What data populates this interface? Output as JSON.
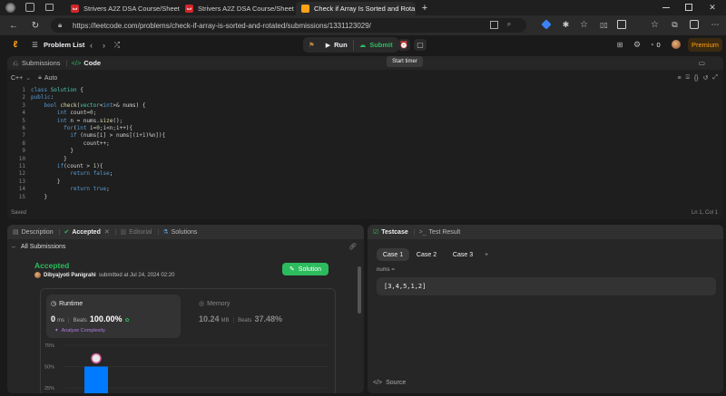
{
  "browser": {
    "tabs": [
      {
        "title": "Strivers A2Z DSA Course/Sheet -",
        "favicon": "tuf",
        "active": false
      },
      {
        "title": "Strivers A2Z DSA Course/Sheet -",
        "favicon": "tuf",
        "active": false
      },
      {
        "title": "Check if Array Is Sorted and Rota",
        "favicon": "leetcode",
        "active": true
      }
    ],
    "favicon_tuf_text": "tuf",
    "new_tab_glyph": "+",
    "url": "https://leetcode.com/problems/check-if-array-is-sorted-and-rotated/submissions/1331123029/"
  },
  "nav": {
    "problem_list": "Problem List",
    "run": "Run",
    "submit": "Submit",
    "tooltip": "Start timer",
    "streak": "0",
    "premium": "Premium"
  },
  "editor": {
    "tab_submissions": "Submissions",
    "tab_code": "Code",
    "language": "C++",
    "auto": "Auto",
    "status": "Saved",
    "cursor": "Ln 1, Col 1",
    "line_numbers": [
      "1",
      "2",
      "3",
      "4",
      "5",
      "6",
      "7",
      "8",
      "9",
      "10",
      "11",
      "12",
      "13",
      "14",
      "15"
    ],
    "code_lines": [
      "class Solution {",
      "public:",
      "    bool check(vector<int>& nums) {",
      "        int count=0;",
      "        int n = nums.size();",
      "          for(int i=0;i<n;i++){",
      "            if (nums[i] > nums[(i+1)%n]){",
      "                count++;",
      "            }",
      "          }",
      "        if(count > 1){",
      "            return false;",
      "        }",
      "            return true;",
      "    }"
    ]
  },
  "left_panel": {
    "tabs": {
      "description": "Description",
      "accepted": "Accepted",
      "editorial": "Editorial",
      "solutions": "Solutions"
    },
    "back": "All Submissions",
    "status": "Accepted",
    "user": "Dibyajyoti Panigrahi",
    "submitted_at": "submitted at Jul 24, 2024 02:20",
    "solution_button": "Solution",
    "runtime": {
      "label": "Runtime",
      "value": "0",
      "unit": "ms",
      "beats_label": "Beats",
      "beats": "100.00%",
      "analyze": "Analyze Complexity"
    },
    "memory": {
      "label": "Memory",
      "value": "10.24",
      "unit": "MB",
      "beats_label": "Beats",
      "beats": "37.48%"
    }
  },
  "chart_data": {
    "type": "bar",
    "ylabels": [
      "75%",
      "50%",
      "25%"
    ],
    "yticks": [
      75,
      50,
      25
    ],
    "ylim": [
      25,
      75
    ],
    "values": [
      50
    ],
    "bar_color": "#007aff"
  },
  "right_panel": {
    "tab_testcase": "Testcase",
    "tab_result": "Test Result",
    "cases": [
      "Case 1",
      "Case 2",
      "Case 3"
    ],
    "add_case": "+",
    "param_label": "nums =",
    "param_value": "[3,4,5,1,2]",
    "source": "Source"
  },
  "colors": {
    "accent_green": "#2cbb5d",
    "accent_orange": "#ffa116",
    "bar_blue": "#007aff"
  }
}
